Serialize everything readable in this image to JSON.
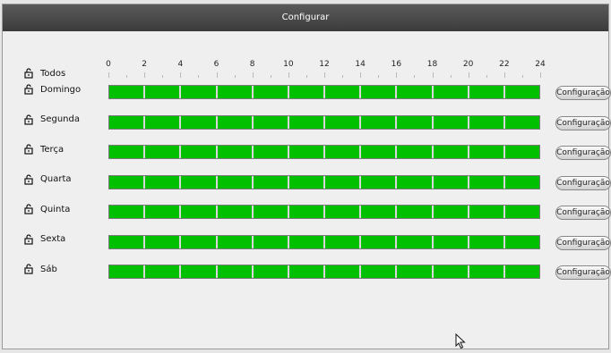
{
  "window": {
    "title": "Configurar"
  },
  "schedule": {
    "all_label": "Todos",
    "hours": [
      "0",
      "2",
      "4",
      "6",
      "8",
      "10",
      "12",
      "14",
      "16",
      "18",
      "20",
      "22",
      "24"
    ],
    "button_label": "Configuração",
    "fill_color": "#00c000",
    "days": [
      {
        "label": "Domingo",
        "button_label": "Configuração"
      },
      {
        "label": "Segunda",
        "button_label": "Configuração"
      },
      {
        "label": "Terça",
        "button_label": "Configuração"
      },
      {
        "label": "Quarta",
        "button_label": "Configuração"
      },
      {
        "label": "Quinta",
        "button_label": "Configuração"
      },
      {
        "label": "Sexta",
        "button_label": "Configuração"
      },
      {
        "label": "Sáb",
        "button_label": "Configuração"
      }
    ]
  }
}
